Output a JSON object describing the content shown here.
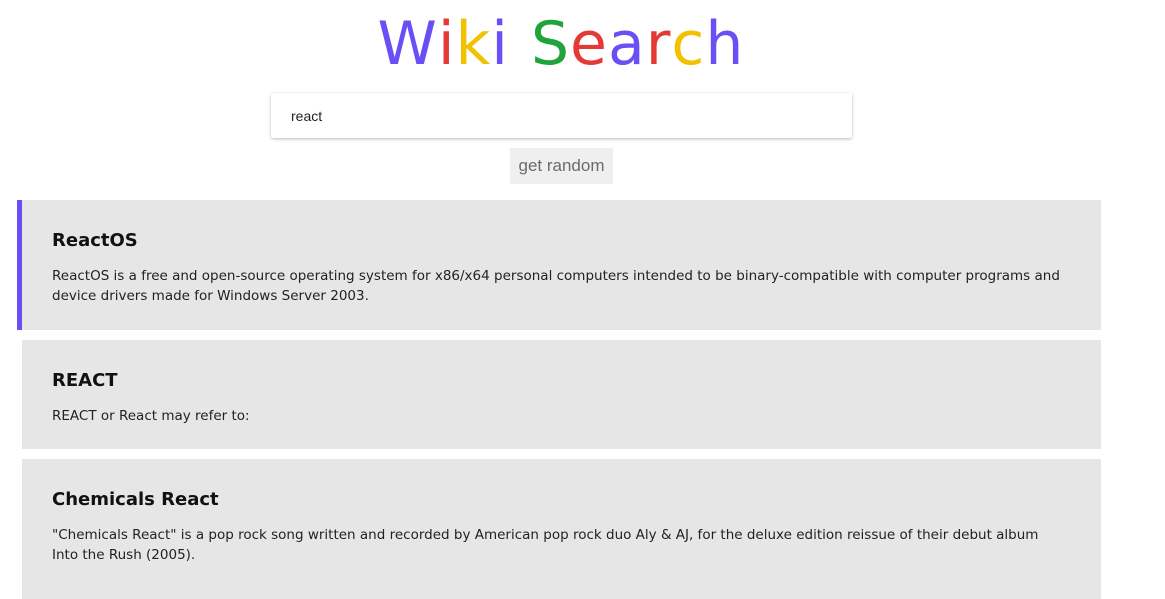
{
  "header": {
    "title_letters": [
      {
        "char": "W",
        "color": "#6b4ef5"
      },
      {
        "char": "i",
        "color": "#e53935"
      },
      {
        "char": "k",
        "color": "#f2c200"
      },
      {
        "char": "i",
        "color": "#6b4ef5"
      },
      {
        "char": " ",
        "color": "#ffffff"
      },
      {
        "char": "S",
        "color": "#21a33b"
      },
      {
        "char": "e",
        "color": "#e53935"
      },
      {
        "char": "a",
        "color": "#6b4ef5"
      },
      {
        "char": "r",
        "color": "#e53935"
      },
      {
        "char": "c",
        "color": "#f2c200"
      },
      {
        "char": "h",
        "color": "#6b4ef5"
      }
    ]
  },
  "search": {
    "value": "react",
    "placeholder": ""
  },
  "actions": {
    "random_label": "get random"
  },
  "colors": {
    "accent": "#6b4ef5",
    "card_bg": "#e6e6e6"
  },
  "results": [
    {
      "title": "ReactOS",
      "snippet": "ReactOS is a free and open-source operating system for x86/x64 personal computers intended to be binary-compatible with computer programs and device drivers made for Windows Server 2003.",
      "active": true
    },
    {
      "title": "REACT",
      "snippet": "REACT or React may refer to:",
      "active": false
    },
    {
      "title": "Chemicals React",
      "snippet": "\"Chemicals React\" is a pop rock song written and recorded by American pop rock duo Aly & AJ, for the deluxe edition reissue of their debut album Into the Rush (2005).",
      "active": false
    }
  ]
}
